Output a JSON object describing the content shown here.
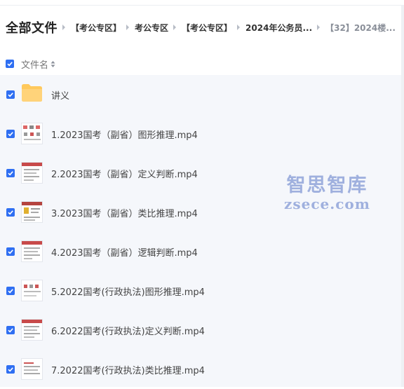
{
  "breadcrumb": {
    "root": "全部文件",
    "items": [
      "【考公专区】",
      "考公专区",
      "【考公专区】",
      "2024年公务员...",
      "【32】2024楼..."
    ]
  },
  "header": {
    "column_label": "文件名",
    "sort_icon": "sort-icon"
  },
  "files": [
    {
      "name": "讲义",
      "type": "folder"
    },
    {
      "name": "1.2023国考（副省）图形推理.mp4",
      "type": "video"
    },
    {
      "name": "2.2023国考（副省）定义判断.mp4",
      "type": "video"
    },
    {
      "name": "3.2023国考（副省）类比推理.mp4",
      "type": "video"
    },
    {
      "name": "4.2023国考（副省）逻辑判断.mp4",
      "type": "video"
    },
    {
      "name": "5.2022国考(行政执法)图形推理.mp4",
      "type": "video"
    },
    {
      "name": "6.2022国考(行政执法)定义判断.mp4",
      "type": "video"
    },
    {
      "name": "7.2022国考(行政执法)类比推理.mp4",
      "type": "video"
    }
  ],
  "watermark": {
    "line1": "智思智库",
    "line2": "zsece.com"
  },
  "colors": {
    "accent": "#2f6ff2",
    "list_bg": "#f5f7fb",
    "folder": "#ffc95c"
  }
}
